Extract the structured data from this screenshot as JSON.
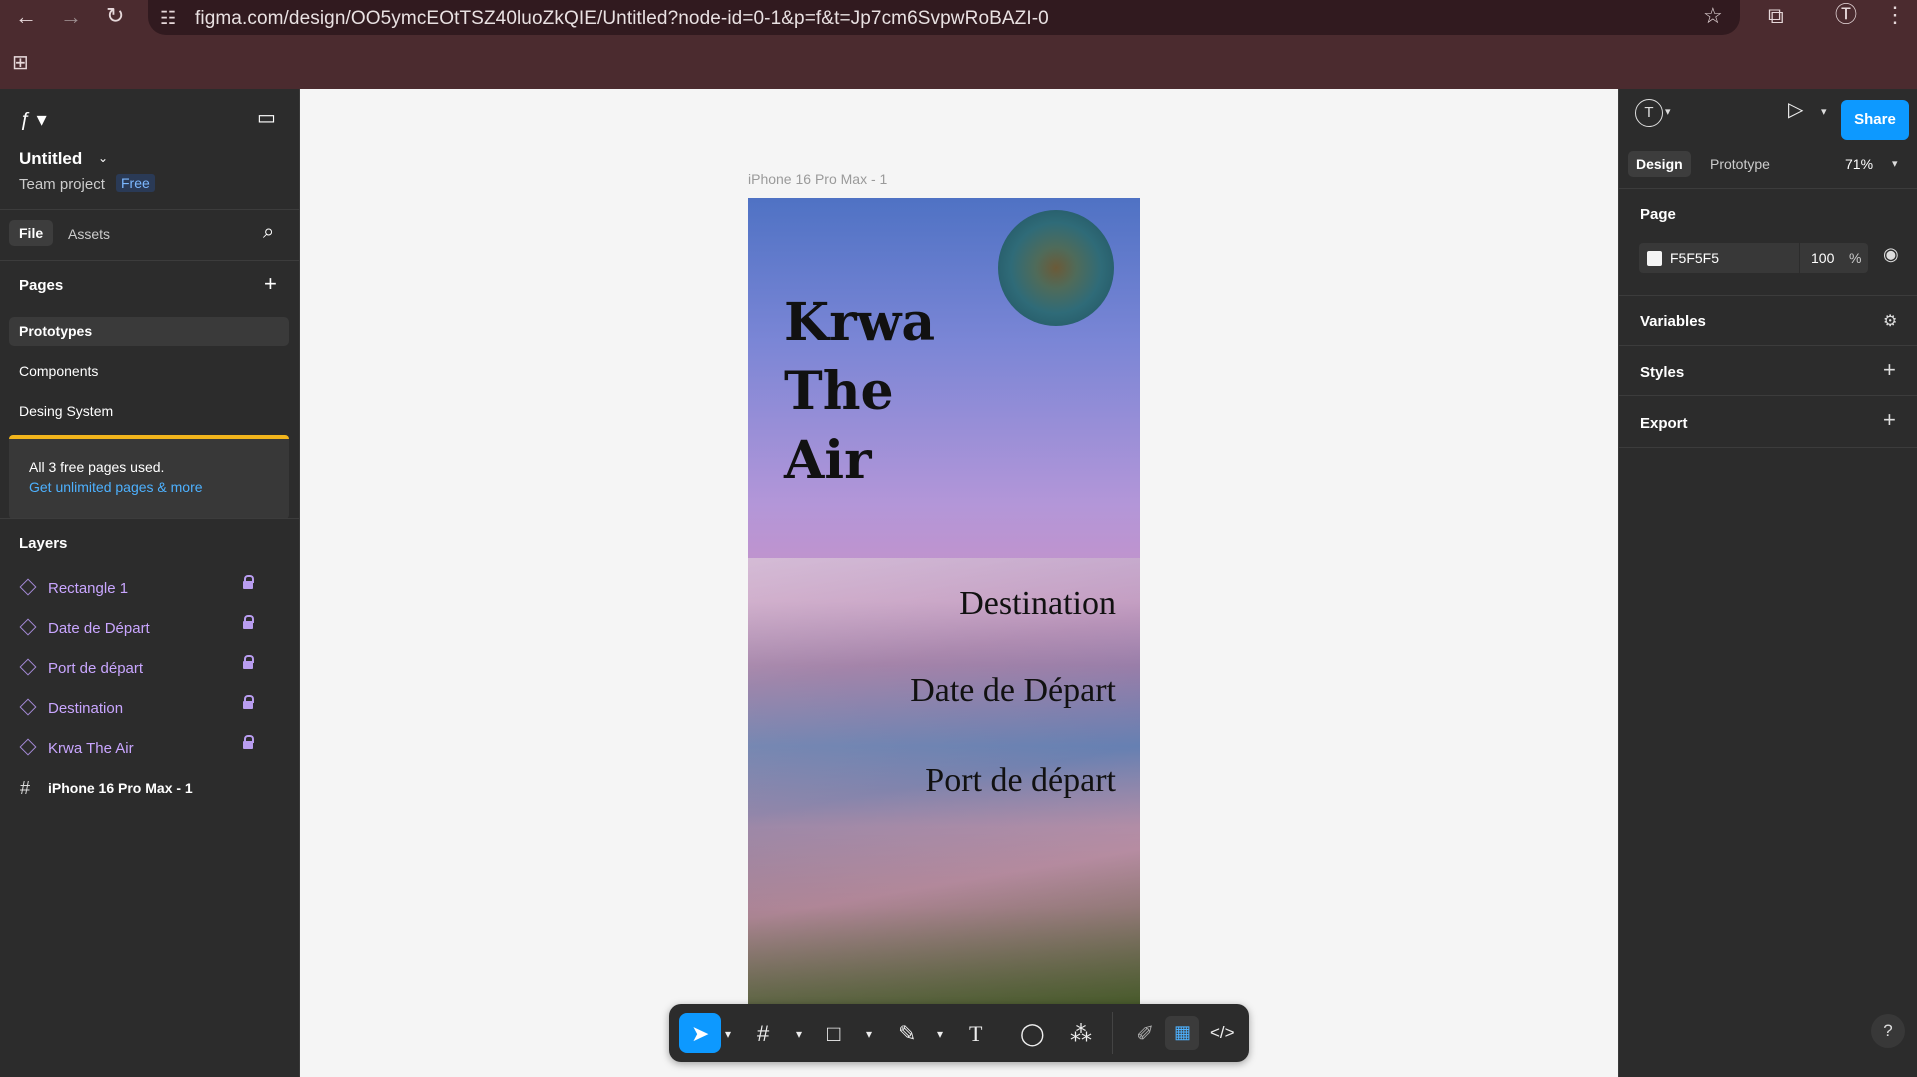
{
  "browser": {
    "url": "figma.com/design/OO5ymcEOtTSZ40luoZkQIE/Untitled?node-id=0-1&p=f&t=Jp7cm6SvpwRoBAZI-0"
  },
  "file": {
    "name": "Untitled",
    "team": "Team project",
    "plan_badge": "Free"
  },
  "left_tabs": {
    "file": "File",
    "assets": "Assets"
  },
  "pages": {
    "title": "Pages",
    "items": [
      "Prototypes",
      "Components",
      "Desing System"
    ],
    "notice_line1": "All 3 free pages used.",
    "notice_link": "Get unlimited pages & more"
  },
  "layers": {
    "title": "Layers",
    "items": [
      "Rectangle 1",
      "Date de Départ",
      "Port de départ",
      "Destination",
      "Krwa The Air"
    ],
    "frame": "iPhone 16 Pro Max - 1"
  },
  "right_panel": {
    "tab_design": "Design",
    "tab_prototype": "Prototype",
    "zoom": "71%",
    "share": "Share",
    "page_title": "Page",
    "page_color": "F5F5F5",
    "page_opacity": "100",
    "percent": "%",
    "variables": "Variables",
    "styles": "Styles",
    "export": "Export"
  },
  "canvas": {
    "frame_label": "iPhone 16 Pro Max - 1",
    "title_line1": "Krwa",
    "title_line2": "The",
    "title_line3": "Air",
    "destination": "Destination",
    "date": "Date de Départ",
    "port": "Port de départ"
  },
  "help": "?"
}
